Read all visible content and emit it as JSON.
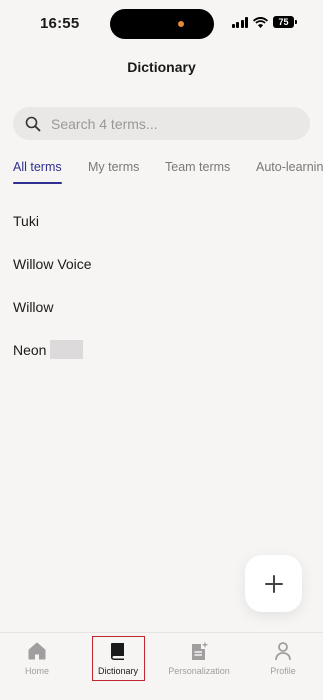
{
  "status_bar": {
    "time": "16:55",
    "battery": "75"
  },
  "header": {
    "title": "Dictionary"
  },
  "search": {
    "placeholder": "Search 4 terms..."
  },
  "tabs": [
    {
      "label": "All terms",
      "active": true
    },
    {
      "label": "My terms",
      "active": false
    },
    {
      "label": "Team terms",
      "active": false
    },
    {
      "label": "Auto-learning",
      "active": false
    }
  ],
  "terms": [
    {
      "label": "Tuki"
    },
    {
      "label": "Willow Voice"
    },
    {
      "label": "Willow"
    },
    {
      "label": "Neon"
    }
  ],
  "fab": {
    "icon": "plus-icon"
  },
  "bottom_nav": [
    {
      "label": "Home",
      "icon": "home-icon",
      "active": false
    },
    {
      "label": "Dictionary",
      "icon": "book-icon",
      "active": true
    },
    {
      "label": "Personalization",
      "icon": "document-sparkle-icon",
      "active": false
    },
    {
      "label": "Profile",
      "icon": "person-icon",
      "active": false
    }
  ],
  "colors": {
    "accent": "#2f2f8f",
    "highlight_box": "#c0282d",
    "background": "#f7f5f3"
  }
}
